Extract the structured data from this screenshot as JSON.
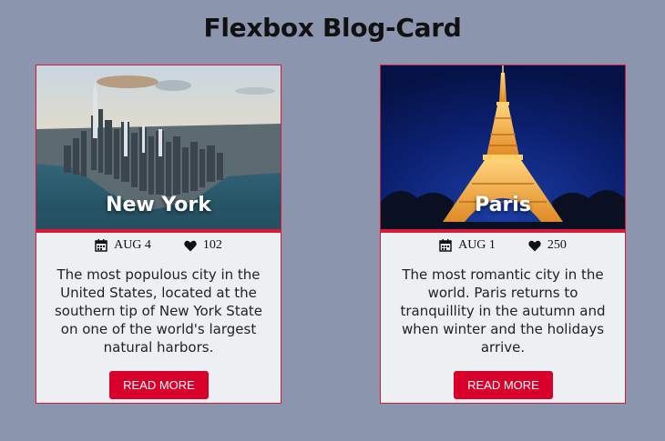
{
  "page": {
    "title": "Flexbox Blog-Card"
  },
  "cards": [
    {
      "title": "New York",
      "date_icon": "calendar-icon",
      "date": "AUG 4",
      "likes_icon": "heart-icon",
      "likes": "102",
      "description": "The most populous city in the United States, located at the southern tip of New York State on one of the world's largest natural harbors.",
      "button_label": "READ MORE"
    },
    {
      "title": "Paris",
      "date_icon": "calendar-icon",
      "date": "AUG 1",
      "likes_icon": "heart-icon",
      "likes": "250",
      "description": "The most romantic city in the world. Paris returns to tranquillity in the autumn and when winter and the holidays arrive.",
      "button_label": "READ MORE"
    }
  ],
  "colors": {
    "accent": "#d8002b",
    "background": "#8b96ae",
    "card": "#ecf0f3"
  }
}
